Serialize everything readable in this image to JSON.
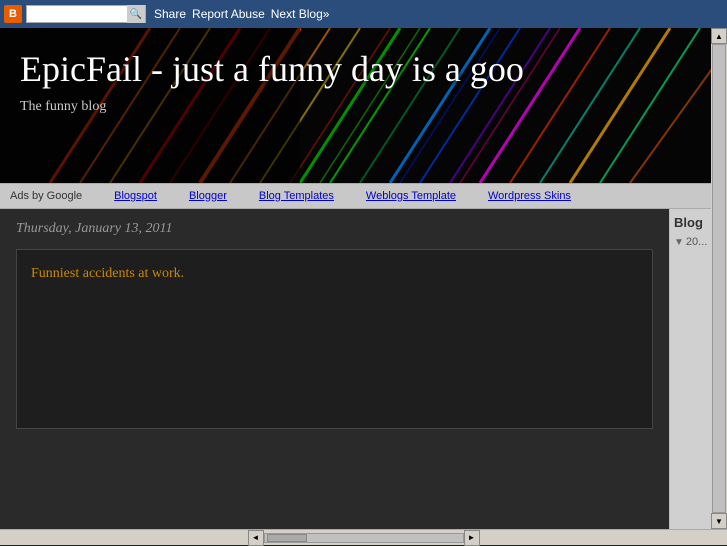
{
  "topbar": {
    "logo_label": "B",
    "search_placeholder": "",
    "search_icon": "🔍",
    "nav_links": [
      {
        "label": "Share",
        "name": "share-link"
      },
      {
        "label": "Report Abuse",
        "name": "report-abuse-link"
      },
      {
        "label": "Next Blog»",
        "name": "next-blog-link"
      }
    ]
  },
  "header": {
    "title": "EpicFail - just a funny day is a goo",
    "subtitle": "The funny blog"
  },
  "ads": {
    "label": "Ads by Google",
    "items": [
      {
        "label": "Blogspot",
        "name": "ad-blogspot"
      },
      {
        "label": "Blogger",
        "name": "ad-blogger"
      },
      {
        "label": "Blog Templates",
        "name": "ad-blog-templates"
      },
      {
        "label": "Weblogs Template",
        "name": "ad-weblogs-template"
      },
      {
        "label": "Wordpress Skins",
        "name": "ad-wordpress-skins"
      }
    ]
  },
  "content": {
    "date": "Thursday, January 13, 2011",
    "post_title": "Funniest accidents at work."
  },
  "sidebar": {
    "blog_label": "Blog",
    "archive_items": [
      {
        "label": "20...",
        "name": "archive-item-1"
      }
    ]
  },
  "scrollbar": {
    "left_arrow": "◄",
    "right_arrow": "►",
    "up_arrow": "▲",
    "down_arrow": "▼"
  }
}
